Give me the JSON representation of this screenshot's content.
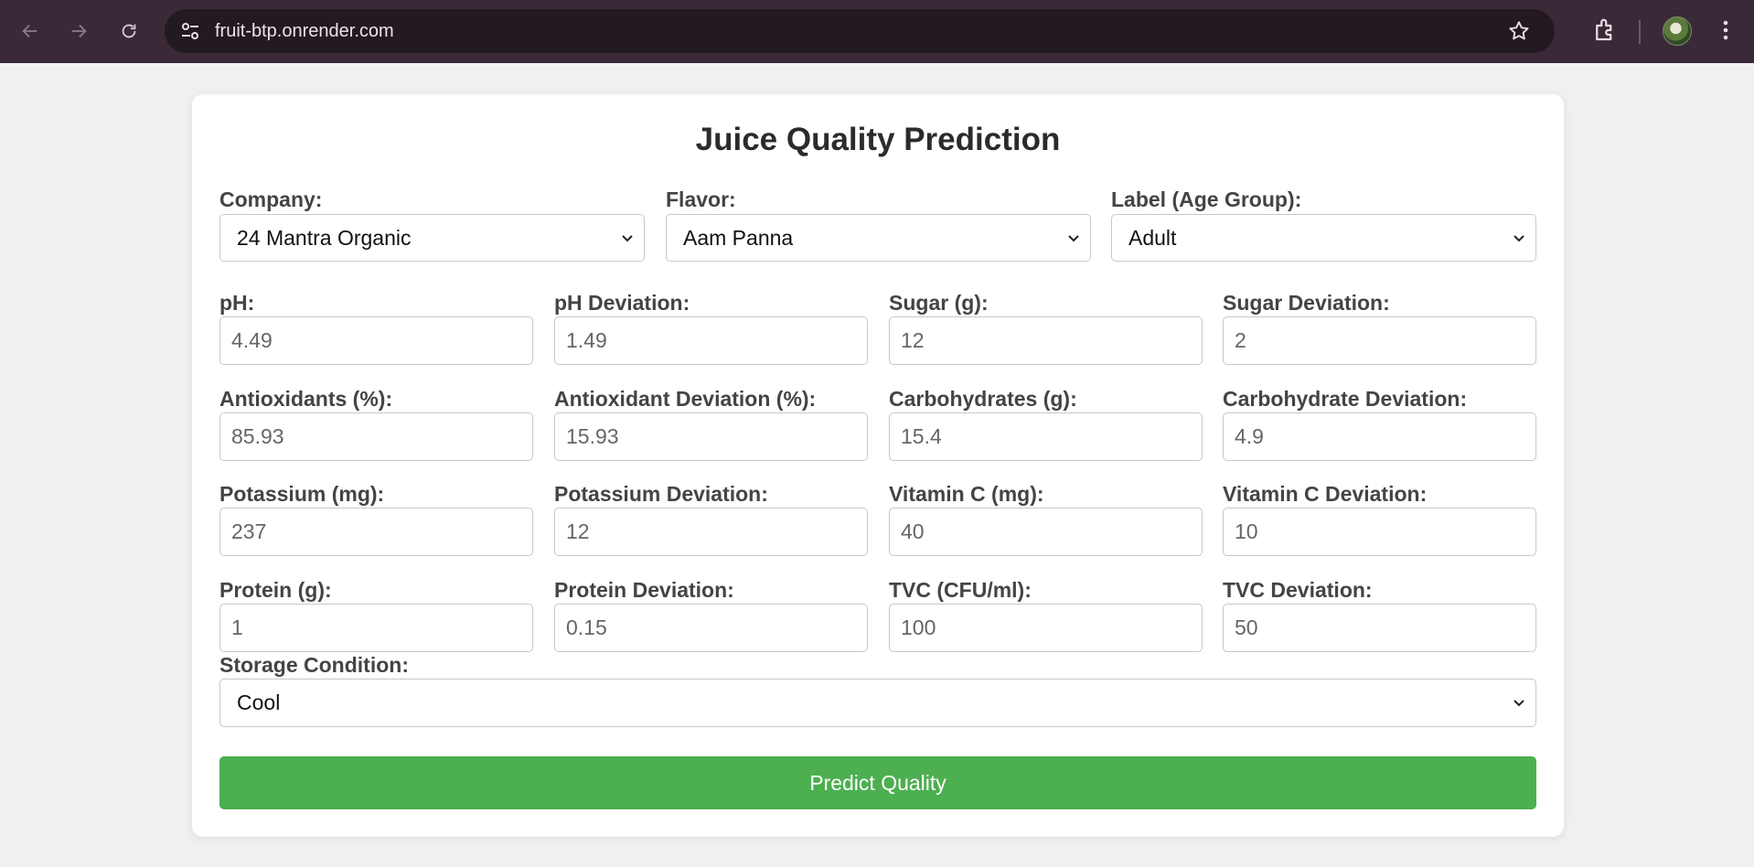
{
  "browser": {
    "url": "fruit-btp.onrender.com"
  },
  "page": {
    "title": "Juice Quality Prediction",
    "selects": {
      "company": {
        "label": "Company:",
        "value": "24 Mantra Organic"
      },
      "flavor": {
        "label": "Flavor:",
        "value": "Aam Panna"
      },
      "age_group": {
        "label": "Label (Age Group):",
        "value": "Adult"
      },
      "storage": {
        "label": "Storage Condition:",
        "value": "Cool"
      }
    },
    "inputs": {
      "ph": {
        "label": "pH:",
        "value": "4.49"
      },
      "ph_dev": {
        "label": "pH Deviation:",
        "value": "1.49"
      },
      "sugar": {
        "label": "Sugar (g):",
        "value": "12"
      },
      "sugar_dev": {
        "label": "Sugar Deviation:",
        "value": "2"
      },
      "antioxidants": {
        "label": "Antioxidants (%):",
        "value": "85.93"
      },
      "antioxidant_dev": {
        "label": "Antioxidant Deviation (%):",
        "value": "15.93"
      },
      "carbohydrates": {
        "label": "Carbohydrates (g):",
        "value": "15.4"
      },
      "carbohydrate_dev": {
        "label": "Carbohydrate Deviation:",
        "value": "4.9"
      },
      "potassium": {
        "label": "Potassium (mg):",
        "value": "237"
      },
      "potassium_dev": {
        "label": "Potassium Deviation:",
        "value": "12"
      },
      "vitamin_c": {
        "label": "Vitamin C (mg):",
        "value": "40"
      },
      "vitamin_c_dev": {
        "label": "Vitamin C Deviation:",
        "value": "10"
      },
      "protein": {
        "label": "Protein (g):",
        "value": "1"
      },
      "protein_dev": {
        "label": "Protein Deviation:",
        "value": "0.15"
      },
      "tvc": {
        "label": "TVC (CFU/ml):",
        "value": "100"
      },
      "tvc_dev": {
        "label": "TVC Deviation:",
        "value": "50"
      }
    },
    "predict_label": "Predict Quality"
  },
  "colors": {
    "chrome": "#3a2a37",
    "button": "#4caf50"
  }
}
